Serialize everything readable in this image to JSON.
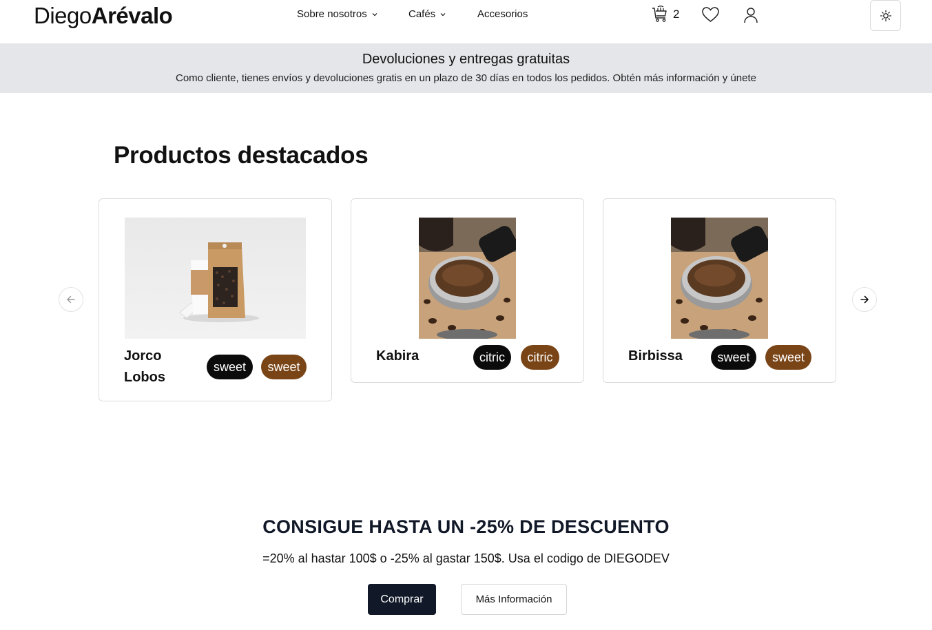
{
  "header": {
    "logo_regular": "Diego",
    "logo_bold": "Arévalo",
    "nav": [
      {
        "label": "Sobre nosotros",
        "has_dropdown": true
      },
      {
        "label": "Cafés",
        "has_dropdown": true
      },
      {
        "label": "Accesorios",
        "has_dropdown": false
      }
    ],
    "cart_count": "2",
    "icons": {
      "cart": "shopping-cart-icon",
      "wishlist": "heart-icon",
      "account": "user-icon",
      "theme": "sun-icon"
    }
  },
  "announcement": {
    "title": "Devoluciones y entregas gratuitas",
    "text": "Como cliente, tienes envíos y devoluciones gratis en un plazo de 30 días en todos los pedidos. Obtén más información y únete"
  },
  "featured": {
    "title": "Productos destacados",
    "products": [
      {
        "name_line1": "Jorco",
        "name_line2": "Lobos",
        "tags": [
          "sweet",
          "sweet"
        ],
        "image": "coffee-bag-and-cup"
      },
      {
        "name": "Kabira",
        "tags": [
          "citric",
          "citric"
        ],
        "image": "portafilter-with-ground-coffee"
      },
      {
        "name": "Birbissa",
        "tags": [
          "sweet",
          "sweet"
        ],
        "image": "portafilter-with-ground-coffee"
      }
    ]
  },
  "promo": {
    "title": "CONSIGUE HASTA UN -25% DE DESCUENTO",
    "text": "=20% al hastar 100$ o -25% al gastar 150$. Usa el codigo de DIEGODEV",
    "buy_label": "Comprar",
    "info_label": "Más Información"
  },
  "colors": {
    "accent_dark": "#111827",
    "tag_dark": "#0b0b0b",
    "tag_brown": "#7a4516",
    "announce_bg": "#e5e6ea"
  }
}
